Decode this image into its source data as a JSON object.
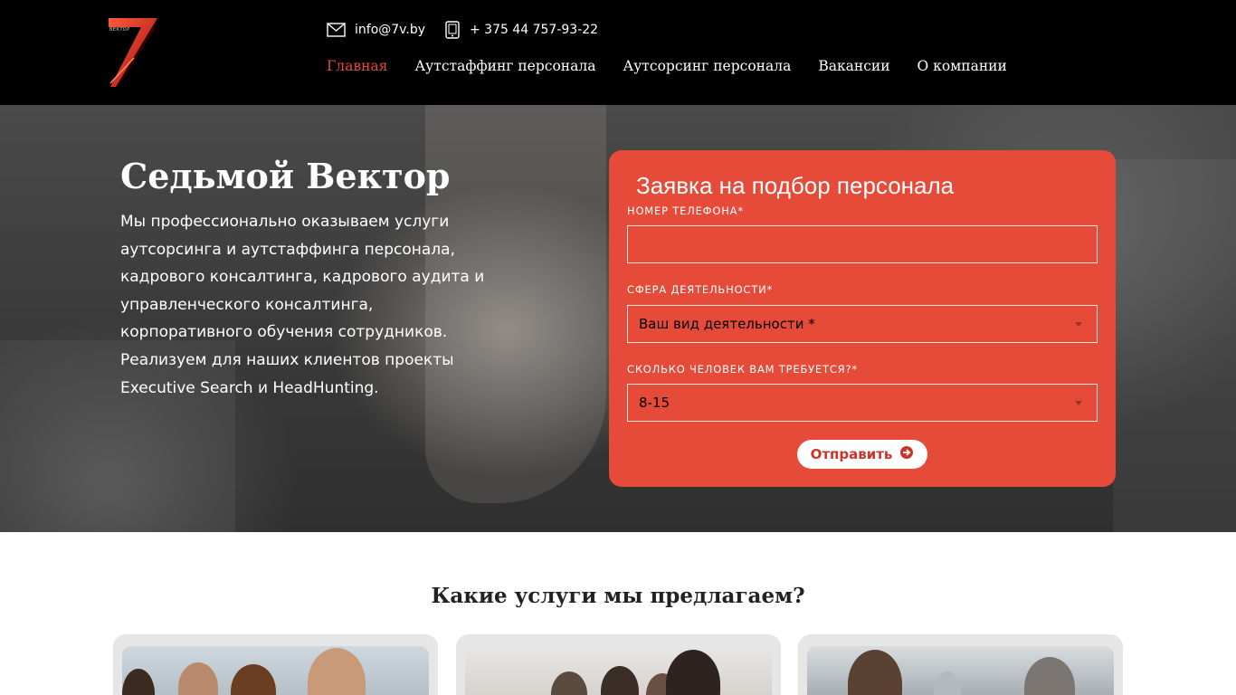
{
  "header": {
    "logo_text": "ВЕКТОР",
    "email": "info@7v.by",
    "phone": "+ 375 44 757-93-22",
    "nav": [
      {
        "label": "Главная",
        "active": true
      },
      {
        "label": "Аутстаффинг персонала",
        "active": false
      },
      {
        "label": "Аутсорсинг персонала",
        "active": false
      },
      {
        "label": "Вакансии",
        "active": false
      },
      {
        "label": "О компании",
        "active": false
      }
    ]
  },
  "hero": {
    "title": "Седьмой Вектор",
    "description": "Мы профессионально оказываем услуги аутсорсинга и аутстаффинга персонала, кадрового консалтинга, кадрового аудита и управленческого консалтинга, корпоративного обучения сотрудников. Реализуем для наших клиентов проекты Executive Search и HeadHunting."
  },
  "form": {
    "title": "Заявка на подбор персонала",
    "phone_label": "НОМЕР ТЕЛЕФОНА*",
    "phone_value": "",
    "sphere_label": "СФЕРА ДЕЯТЕЛЬНОСТИ*",
    "sphere_value": "Ваш вид деятельности *",
    "count_label": "СКОЛЬКО ЧЕЛОВЕК ВАМ ТРЕБУЕТСЯ?*",
    "count_value": "8-15",
    "submit_label": "Отправить"
  },
  "services": {
    "title": "Какие услуги мы предлагаем?"
  },
  "colors": {
    "accent": "#e54b38",
    "nav_active": "#e24b3a",
    "header_bg": "#000000"
  }
}
